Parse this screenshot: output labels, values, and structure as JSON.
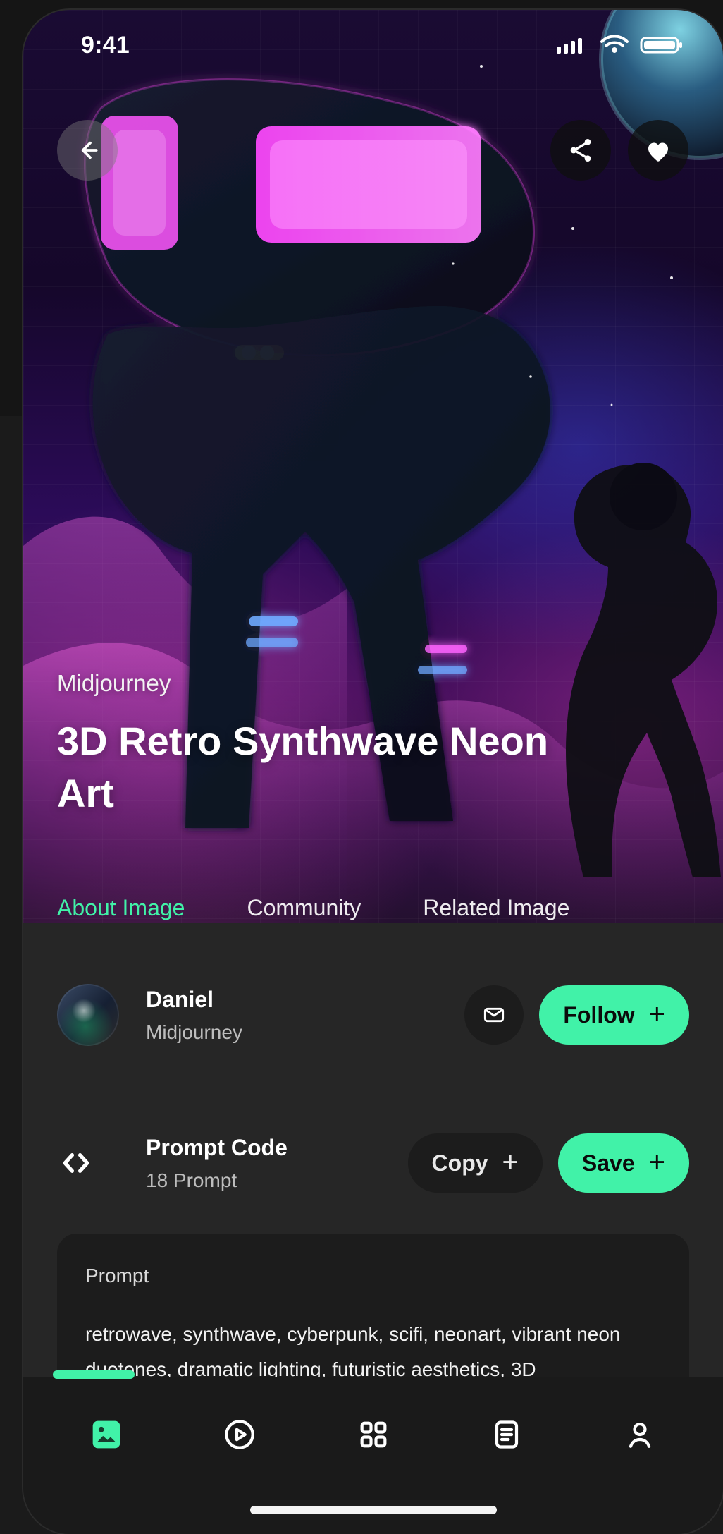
{
  "status_bar": {
    "time": "9:41"
  },
  "hero": {
    "kicker": "Midjourney",
    "title": "3D Retro Synthwave Neon Art"
  },
  "tabs": [
    {
      "label": "About Image",
      "active": true
    },
    {
      "label": "Community",
      "active": false
    },
    {
      "label": "Related Image",
      "active": false
    }
  ],
  "author": {
    "name": "Daniel",
    "source": "Midjourney",
    "follow_label": "Follow"
  },
  "prompt": {
    "title": "Prompt Code",
    "count_label": "18 Prompt",
    "copy_label": "Copy",
    "save_label": "Save",
    "card_label": "Prompt",
    "text": "retrowave, synthwave, cyberpunk, scifi, neonart,  vibrant neon duotones, dramatic lighting, futuristic aesthetics, 3D"
  },
  "icons": {
    "back": "back-arrow-icon",
    "share": "share-icon",
    "like": "heart-icon",
    "mail": "mail-icon",
    "code": "code-brackets-icon",
    "nav": [
      "images-icon",
      "play-icon",
      "grid-icon",
      "notes-icon",
      "profile-icon"
    ]
  },
  "colors": {
    "accent": "#41f2a8",
    "background": "#262626",
    "card": "#1c1c1c"
  }
}
